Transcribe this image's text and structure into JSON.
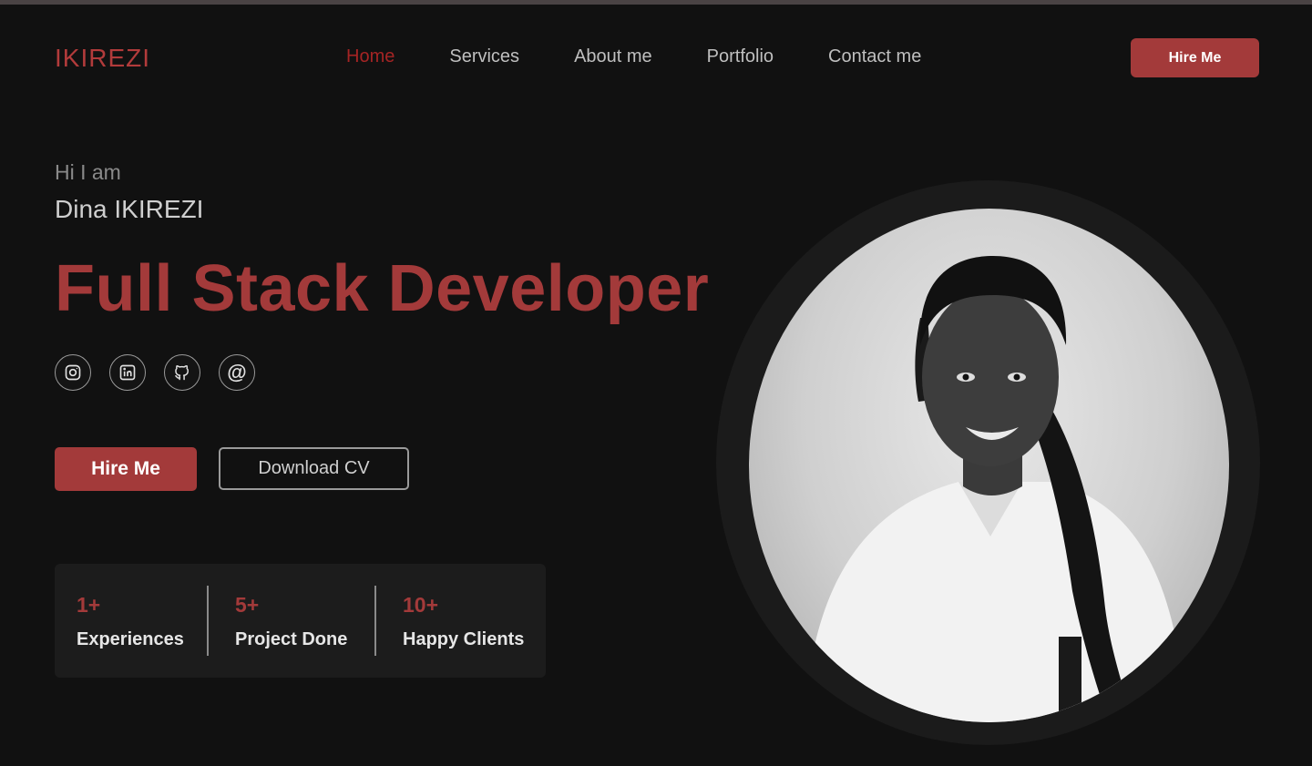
{
  "brand": {
    "logo": "IKIREZI",
    "accent": "#a33a3a"
  },
  "nav": {
    "items": [
      {
        "label": "Home",
        "active": true
      },
      {
        "label": "Services",
        "active": false
      },
      {
        "label": "About me",
        "active": false
      },
      {
        "label": "Portfolio",
        "active": false
      },
      {
        "label": "Contact me",
        "active": false
      }
    ],
    "cta_label": "Hire Me"
  },
  "hero": {
    "greeting": "Hi I am",
    "name": "Dina IKIREZI",
    "role": "Full Stack Developer",
    "socials": [
      "instagram-icon",
      "linkedin-icon",
      "github-icon",
      "at-icon"
    ],
    "at_symbol": "@",
    "primary_button": "Hire Me",
    "secondary_button": "Download CV"
  },
  "stats": [
    {
      "value": "1+",
      "label": "Experiences"
    },
    {
      "value": "5+",
      "label": "Project Done"
    },
    {
      "value": "10+",
      "label": "Happy Clients"
    }
  ],
  "portrait": {
    "description_icon": "profile-photo"
  }
}
